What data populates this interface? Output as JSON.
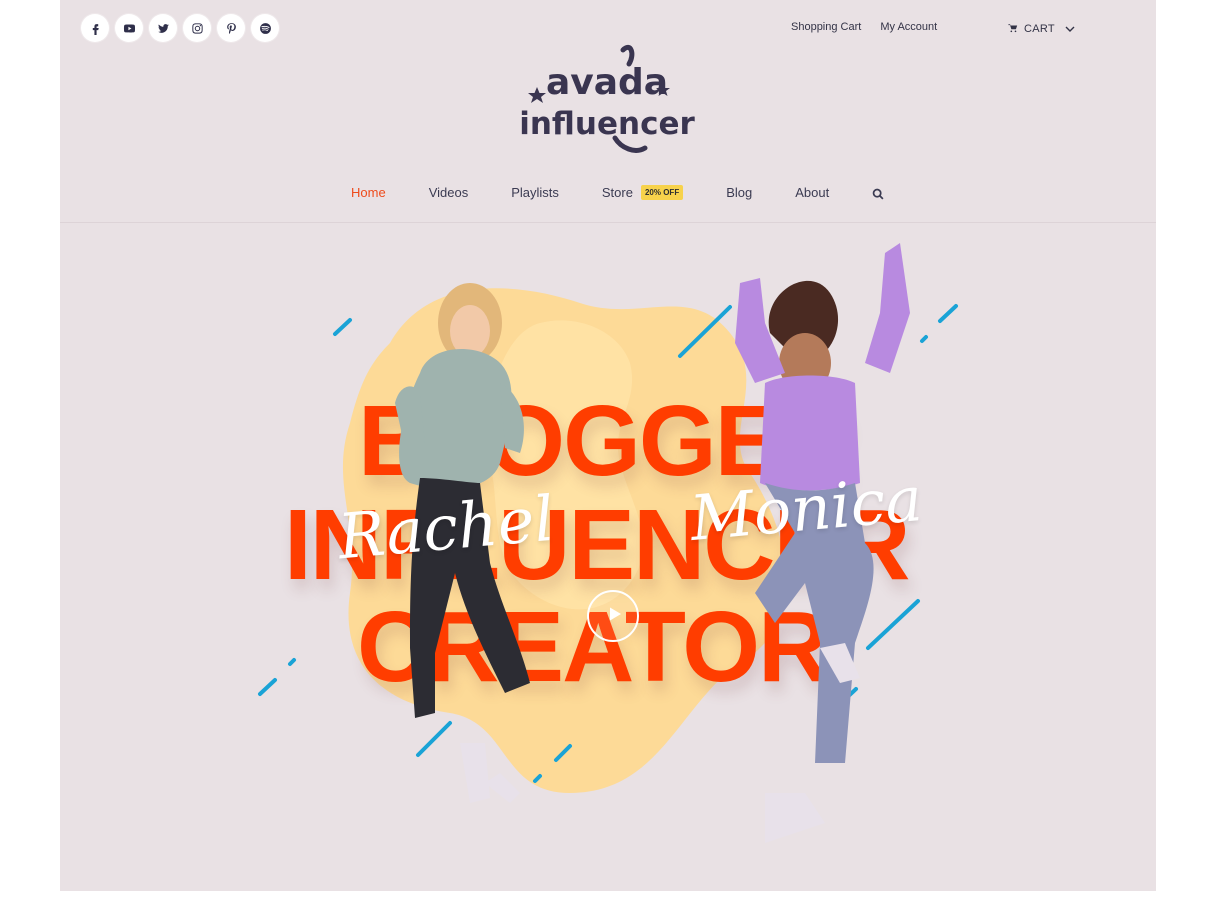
{
  "header": {
    "social_icons": [
      {
        "name": "facebook-icon"
      },
      {
        "name": "youtube-icon"
      },
      {
        "name": "twitter-icon"
      },
      {
        "name": "instagram-icon"
      },
      {
        "name": "pinterest-icon"
      },
      {
        "name": "spotify-icon"
      }
    ],
    "secondary_links": [
      "Shopping Cart",
      "My Account"
    ],
    "cart_label": "CART",
    "logo": {
      "line1": "avada",
      "line2": "influencer"
    },
    "nav": {
      "items": [
        "Home",
        "Videos",
        "Playlists",
        "Store",
        "Blog",
        "About"
      ],
      "active": "Home",
      "store_badge": "20% OFF"
    }
  },
  "hero": {
    "words": [
      "BLOGGER",
      "INFLUENCER",
      "CREATOR"
    ],
    "names": [
      "Rachel",
      "Monica"
    ],
    "play_icon": "play-icon"
  },
  "colors": {
    "background": "#e9e1e4",
    "accent_orange": "#ff3d00",
    "nav_active": "#ee4b1c",
    "badge_yellow": "#f7d24b",
    "stripe_blue": "#1aa3d6",
    "blob_yellow": "#ffd98e",
    "text_dark": "#333346"
  }
}
